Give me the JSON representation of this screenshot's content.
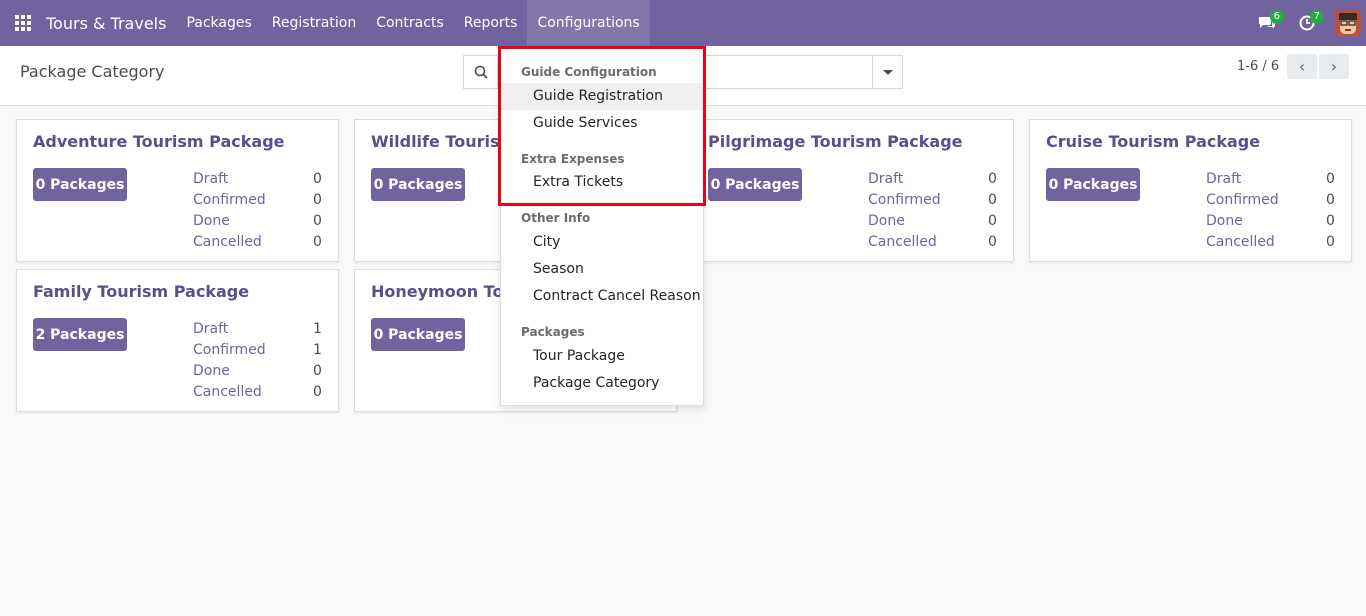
{
  "navbar": {
    "app_title": "Tours & Travels",
    "menu": [
      "Packages",
      "Registration",
      "Contracts",
      "Reports",
      "Configurations"
    ],
    "messages_count": "6",
    "activities_count": "7",
    "color": "#71639e"
  },
  "control": {
    "breadcrumb": "Package Category",
    "pager": "1-6 / 6"
  },
  "cards": [
    {
      "title": "Adventure Tourism Package",
      "button": "0 Packages",
      "stats": [
        {
          "label": "Draft",
          "value": "0"
        },
        {
          "label": "Confirmed",
          "value": "0"
        },
        {
          "label": "Done",
          "value": "0"
        },
        {
          "label": "Cancelled",
          "value": "0"
        }
      ]
    },
    {
      "title": "Wildlife Tourism",
      "button": "0 Packages",
      "stats": []
    },
    {
      "title": "Pilgrimage Tourism Package",
      "button": "0 Packages",
      "stats": [
        {
          "label": "Draft",
          "value": "0"
        },
        {
          "label": "Confirmed",
          "value": "0"
        },
        {
          "label": "Done",
          "value": "0"
        },
        {
          "label": "Cancelled",
          "value": "0"
        }
      ]
    },
    {
      "title": "Cruise Tourism Package",
      "button": "0 Packages",
      "stats": [
        {
          "label": "Draft",
          "value": "0"
        },
        {
          "label": "Confirmed",
          "value": "0"
        },
        {
          "label": "Done",
          "value": "0"
        },
        {
          "label": "Cancelled",
          "value": "0"
        }
      ]
    },
    {
      "title": "Family Tourism Package",
      "button": "2 Packages",
      "stats": [
        {
          "label": "Draft",
          "value": "1"
        },
        {
          "label": "Confirmed",
          "value": "1"
        },
        {
          "label": "Done",
          "value": "0"
        },
        {
          "label": "Cancelled",
          "value": "0"
        }
      ]
    },
    {
      "title": "Honeymoon Touri",
      "button": "0 Packages",
      "stats": []
    }
  ],
  "dropdown": {
    "sections": [
      {
        "header": "Guide Configuration",
        "items": [
          "Guide Registration",
          "Guide Services"
        ]
      },
      {
        "header": "Extra Expenses",
        "items": [
          "Extra Tickets"
        ]
      },
      {
        "header": "Other Info",
        "items": [
          "City",
          "Season",
          "Contract Cancel Reason"
        ]
      },
      {
        "header": "Packages",
        "items": [
          "Tour Package",
          "Package Category"
        ]
      }
    ],
    "hovered_item": "Guide Registration",
    "highlight_color": "#e30613"
  }
}
